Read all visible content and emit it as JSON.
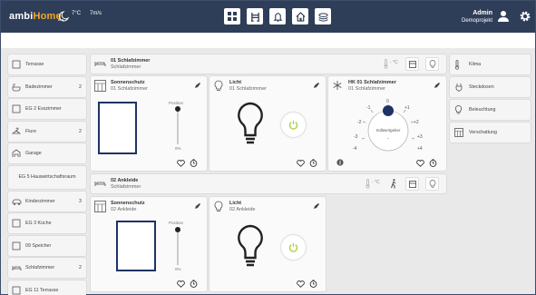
{
  "app": {
    "brand_prefix": "ambi",
    "brand_suffix": "Home"
  },
  "weather": {
    "temp": "7°C",
    "wind": "7m/s"
  },
  "nav": [
    "grid-icon",
    "chair-icon",
    "bell-icon",
    "home-icon",
    "layers-icon"
  ],
  "user": {
    "name": "Admin",
    "project": "Demoprojekt"
  },
  "sidebar": {
    "items": [
      {
        "label": "Terrasse",
        "count": "",
        "icon": "terrace-icon"
      },
      {
        "label": "Badezimmer",
        "count": "2",
        "icon": "bathtub-icon"
      },
      {
        "label": "EG 2 Esszimmer",
        "count": "",
        "icon": "room-icon"
      },
      {
        "label": "Flure",
        "count": "2",
        "icon": "hanger-icon"
      },
      {
        "label": "Garage",
        "count": "",
        "icon": "garage-icon"
      },
      {
        "label": "EG 5 Hauswirtschaftsraum",
        "count": "",
        "icon": ""
      },
      {
        "label": "Kinderzimmer",
        "count": "3",
        "icon": "toy-car-icon"
      },
      {
        "label": "EG 3 Küche",
        "count": "",
        "icon": "room-icon"
      },
      {
        "label": "09 Speicher",
        "count": "",
        "icon": "room-icon"
      },
      {
        "label": "Schlafzimmer",
        "count": "2",
        "icon": "bed-icon"
      },
      {
        "label": "EG 11 Terrasse",
        "count": "",
        "icon": "room-icon"
      }
    ]
  },
  "rooms": [
    {
      "title": "01 Schlafzimmer",
      "subtitle": "Schlafzimmer",
      "temp": "- °C",
      "cards": [
        {
          "title": "Sonnenschutz",
          "subtitle": "01 Schlafzimmer",
          "pos_label": "Position",
          "pos_value": "0%",
          "position": 0
        },
        {
          "title": "Licht",
          "subtitle": "01 Schlafzimmer"
        },
        {
          "title": "HK 01 Schlafzimmer",
          "subtitle": "01 Schlafzimmer",
          "dial_label": "Sollwertgeber",
          "dial_value": "-",
          "dial_ticks": [
            "-4",
            "-3",
            "-2",
            "-1",
            "0",
            "+1",
            "+2",
            "+3",
            "+4"
          ]
        }
      ]
    },
    {
      "title": "02 Ankleide",
      "subtitle": "Schlafzimmer",
      "temp": "- °C",
      "cards": [
        {
          "title": "Sonnenschutz",
          "subtitle": "02 Ankleide",
          "pos_label": "Position",
          "pos_value": "0%",
          "position": 0
        },
        {
          "title": "Licht",
          "subtitle": "02 Ankleide"
        }
      ]
    }
  ],
  "right": {
    "items": [
      {
        "label": "Klima",
        "icon": "thermometer-icon"
      },
      {
        "label": "Steckdosen",
        "icon": "plug-icon"
      },
      {
        "label": "Beleuchtung",
        "icon": "bulb-icon"
      },
      {
        "label": "Verschattung",
        "icon": "window-icon"
      }
    ]
  },
  "colors": {
    "topbar": "#2f3e58",
    "accent": "#f4a62a",
    "power": "#a8d13a",
    "dial": "#1f3264"
  }
}
